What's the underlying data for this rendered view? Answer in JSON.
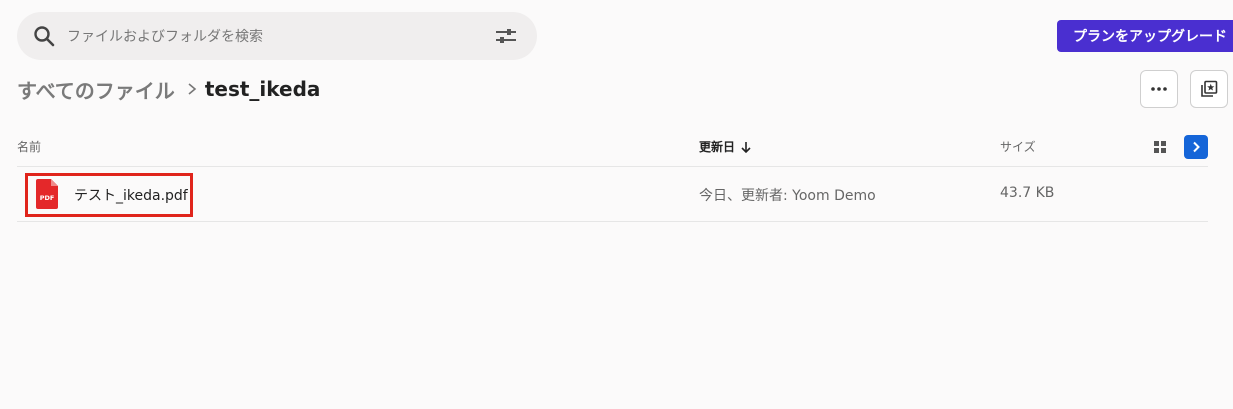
{
  "search": {
    "placeholder": "ファイルおよびフォルダを検索"
  },
  "upgrade_button_label": "プランをアップグレード",
  "breadcrumb": {
    "root": "すべてのファイル",
    "current": "test_ikeda"
  },
  "table": {
    "headers": {
      "name": "名前",
      "modified": "更新日",
      "size": "サイズ"
    },
    "rows": [
      {
        "name": "テスト_ikeda.pdf",
        "modified": "今日、更新者: Yoom Demo",
        "size": "43.7 KB",
        "icon": "pdf-file-icon"
      }
    ]
  },
  "colors": {
    "accent": "#4a2fd0",
    "panel_toggle": "#1565d8",
    "highlight": "#e0241b",
    "pdf_red": "#e4282a"
  }
}
